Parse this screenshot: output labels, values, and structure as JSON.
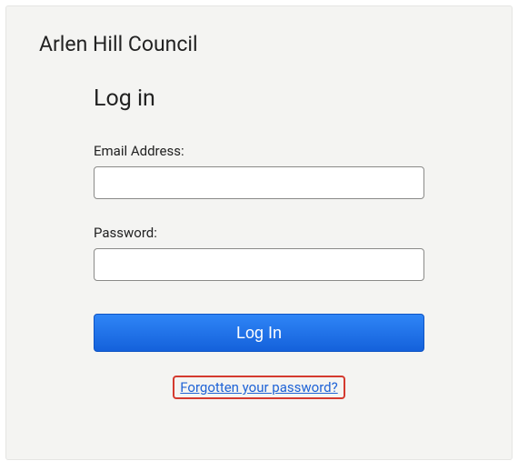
{
  "org": {
    "title": "Arlen Hill Council"
  },
  "login": {
    "heading": "Log in",
    "email_label": "Email Address:",
    "email_value": "",
    "password_label": "Password:",
    "password_value": "",
    "submit_label": "Log In",
    "forgot_label": "Forgotten your password?"
  }
}
